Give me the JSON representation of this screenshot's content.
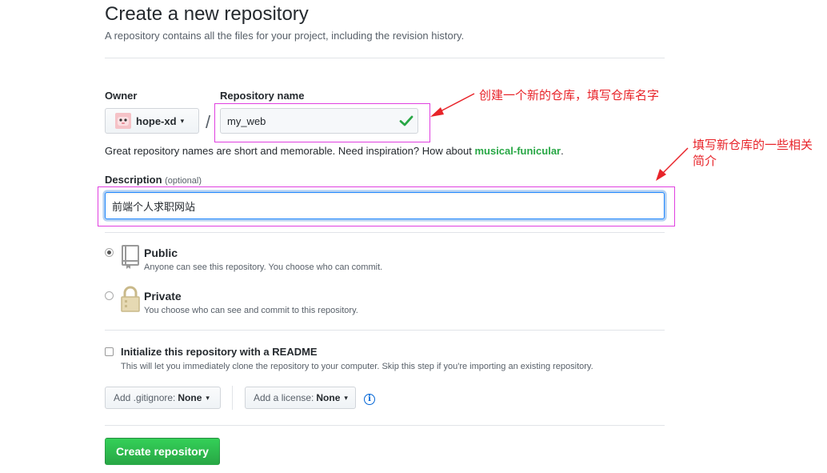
{
  "header": {
    "title": "Create a new repository",
    "subtitle": "A repository contains all the files for your project, including the revision history."
  },
  "owner": {
    "label": "Owner",
    "name": "hope-xd",
    "caret": "▾"
  },
  "repo": {
    "label": "Repository name",
    "slash": "/",
    "value": "my_web",
    "valid_icon": "check-icon"
  },
  "hint": {
    "text": "Great repository names are short and memorable. Need inspiration? How about ",
    "suggestion": "musical-funicular",
    "end": "."
  },
  "description": {
    "label": "Description",
    "optional": "(optional)",
    "value": "前端个人求职网站"
  },
  "visibility": {
    "public": {
      "title": "Public",
      "desc": "Anyone can see this repository. You choose who can commit.",
      "selected": true
    },
    "private": {
      "title": "Private",
      "desc": "You choose who can see and commit to this repository.",
      "selected": false
    }
  },
  "readme": {
    "title": "Initialize this repository with a README",
    "desc": "This will let you immediately clone the repository to your computer. Skip this step if you're importing an existing repository."
  },
  "gitignore": {
    "label": "Add .gitignore:",
    "value": "None"
  },
  "license": {
    "label": "Add a license:",
    "value": "None"
  },
  "info_icon": "i",
  "create_button": "Create repository",
  "annotations": {
    "repo_name_note": "创建一个新的仓库，填写仓库名字",
    "description_note_line1": "填写新仓库的一些相关",
    "description_note_line2": "简介"
  },
  "colors": {
    "primary_green": "#28a745",
    "annotation_red": "#e8242a",
    "annotation_box": "#e040e0",
    "focus_blue": "#2188ff"
  }
}
